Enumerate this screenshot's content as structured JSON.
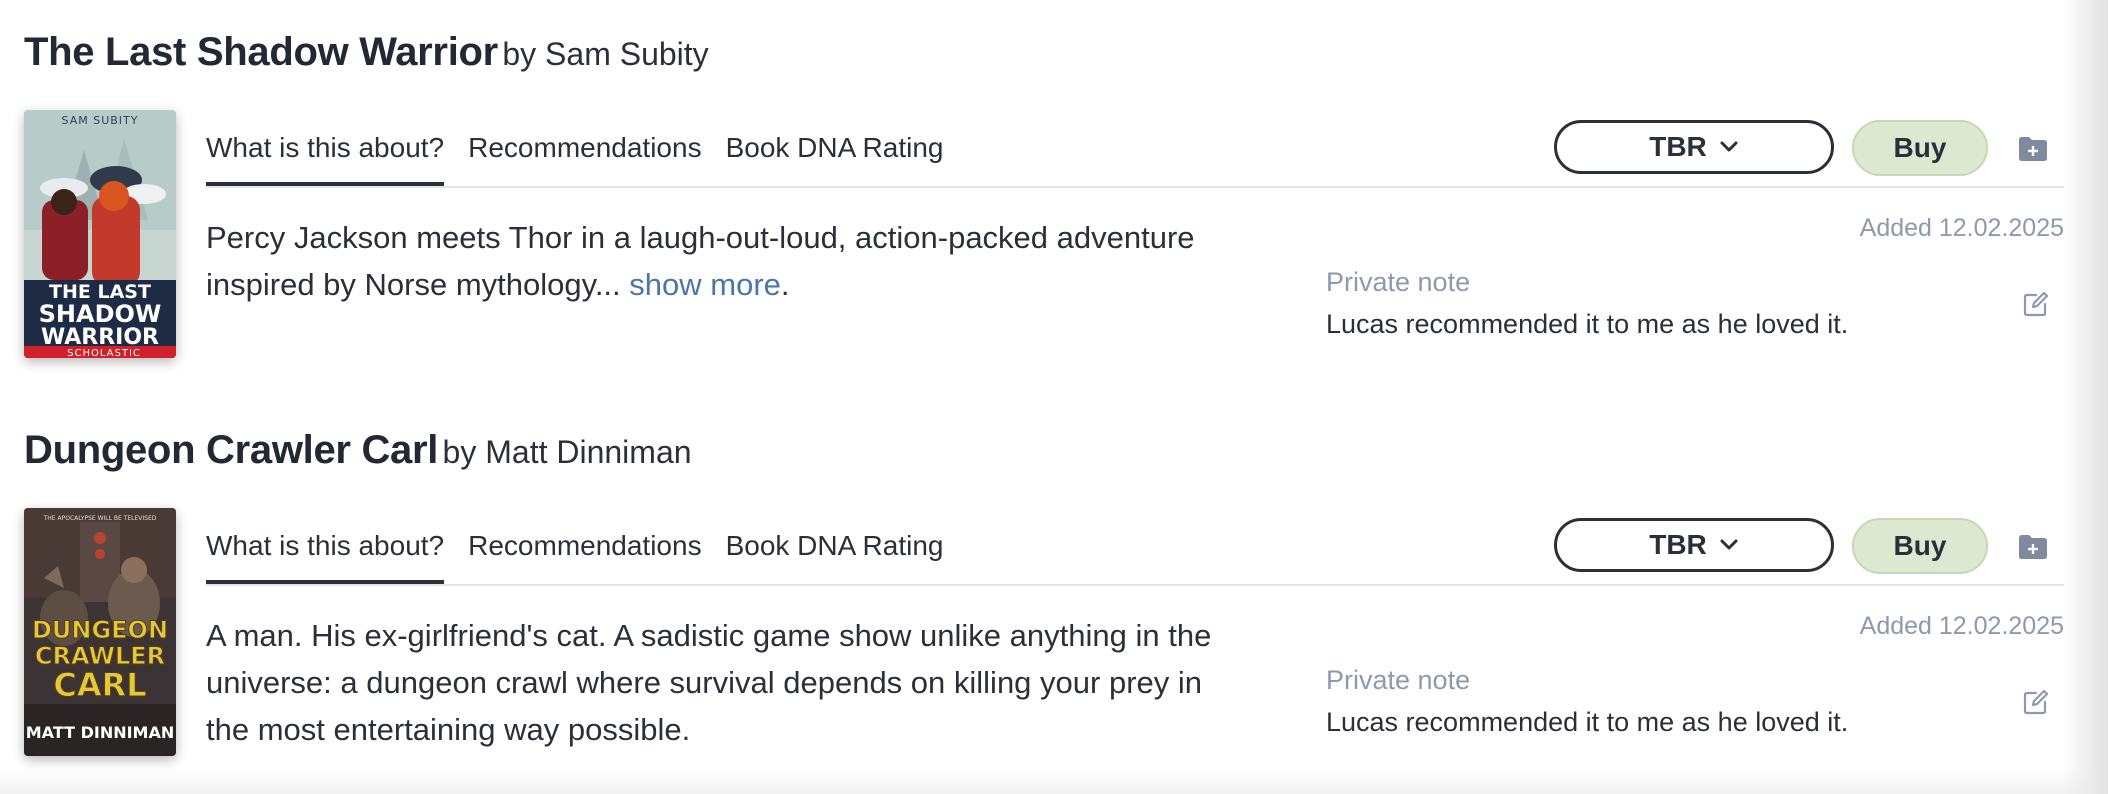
{
  "books": [
    {
      "title": "The Last Shadow Warrior",
      "author_line": "by Sam Subity",
      "cover": {
        "author": "SAM SUBITY",
        "title_lines": [
          "THE LAST",
          "SHADOW",
          "WARRIOR"
        ],
        "publisher": "SCHOLASTIC"
      },
      "tabs": [
        "What is this about?",
        "Recommendations",
        "Book DNA Rating"
      ],
      "shelf_label": "TBR",
      "buy_label": "Buy",
      "description": "Percy Jackson meets Thor in a laugh-out-loud, action-packed adventure inspired by Norse mythology...",
      "show_more": "show more",
      "show_more_suffix": ".",
      "added": "Added 12.02.2025",
      "note_label": "Private note",
      "note_text": "Lucas recommended it to me as he loved it."
    },
    {
      "title": "Dungeon Crawler Carl",
      "author_line": "by Matt Dinniman",
      "cover": {
        "tagline": "THE APOCALYPSE WILL BE TELEVISED",
        "title_lines": [
          "DUNGEON",
          "CRAWLER",
          "CARL"
        ],
        "author": "MATT DINNIMAN"
      },
      "tabs": [
        "What is this about?",
        "Recommendations",
        "Book DNA Rating"
      ],
      "shelf_label": "TBR",
      "buy_label": "Buy",
      "description": "A man. His ex-girlfriend's cat. A sadistic game show unlike anything in the universe: a dungeon crawl where survival depends on killing your prey in the most entertaining way possible.",
      "added": "Added 12.02.2025",
      "note_label": "Private note",
      "note_text": "Lucas recommended it to me as he loved it."
    }
  ],
  "colors": {
    "link": "#4d76a8",
    "buy_bg": "#dce9d0",
    "muted": "#8f99ae",
    "text": "#2a2f3a"
  },
  "icons": {
    "shelf_dropdown": "chevron-down-icon",
    "folder": "folder-add-icon",
    "edit": "edit-note-icon"
  }
}
